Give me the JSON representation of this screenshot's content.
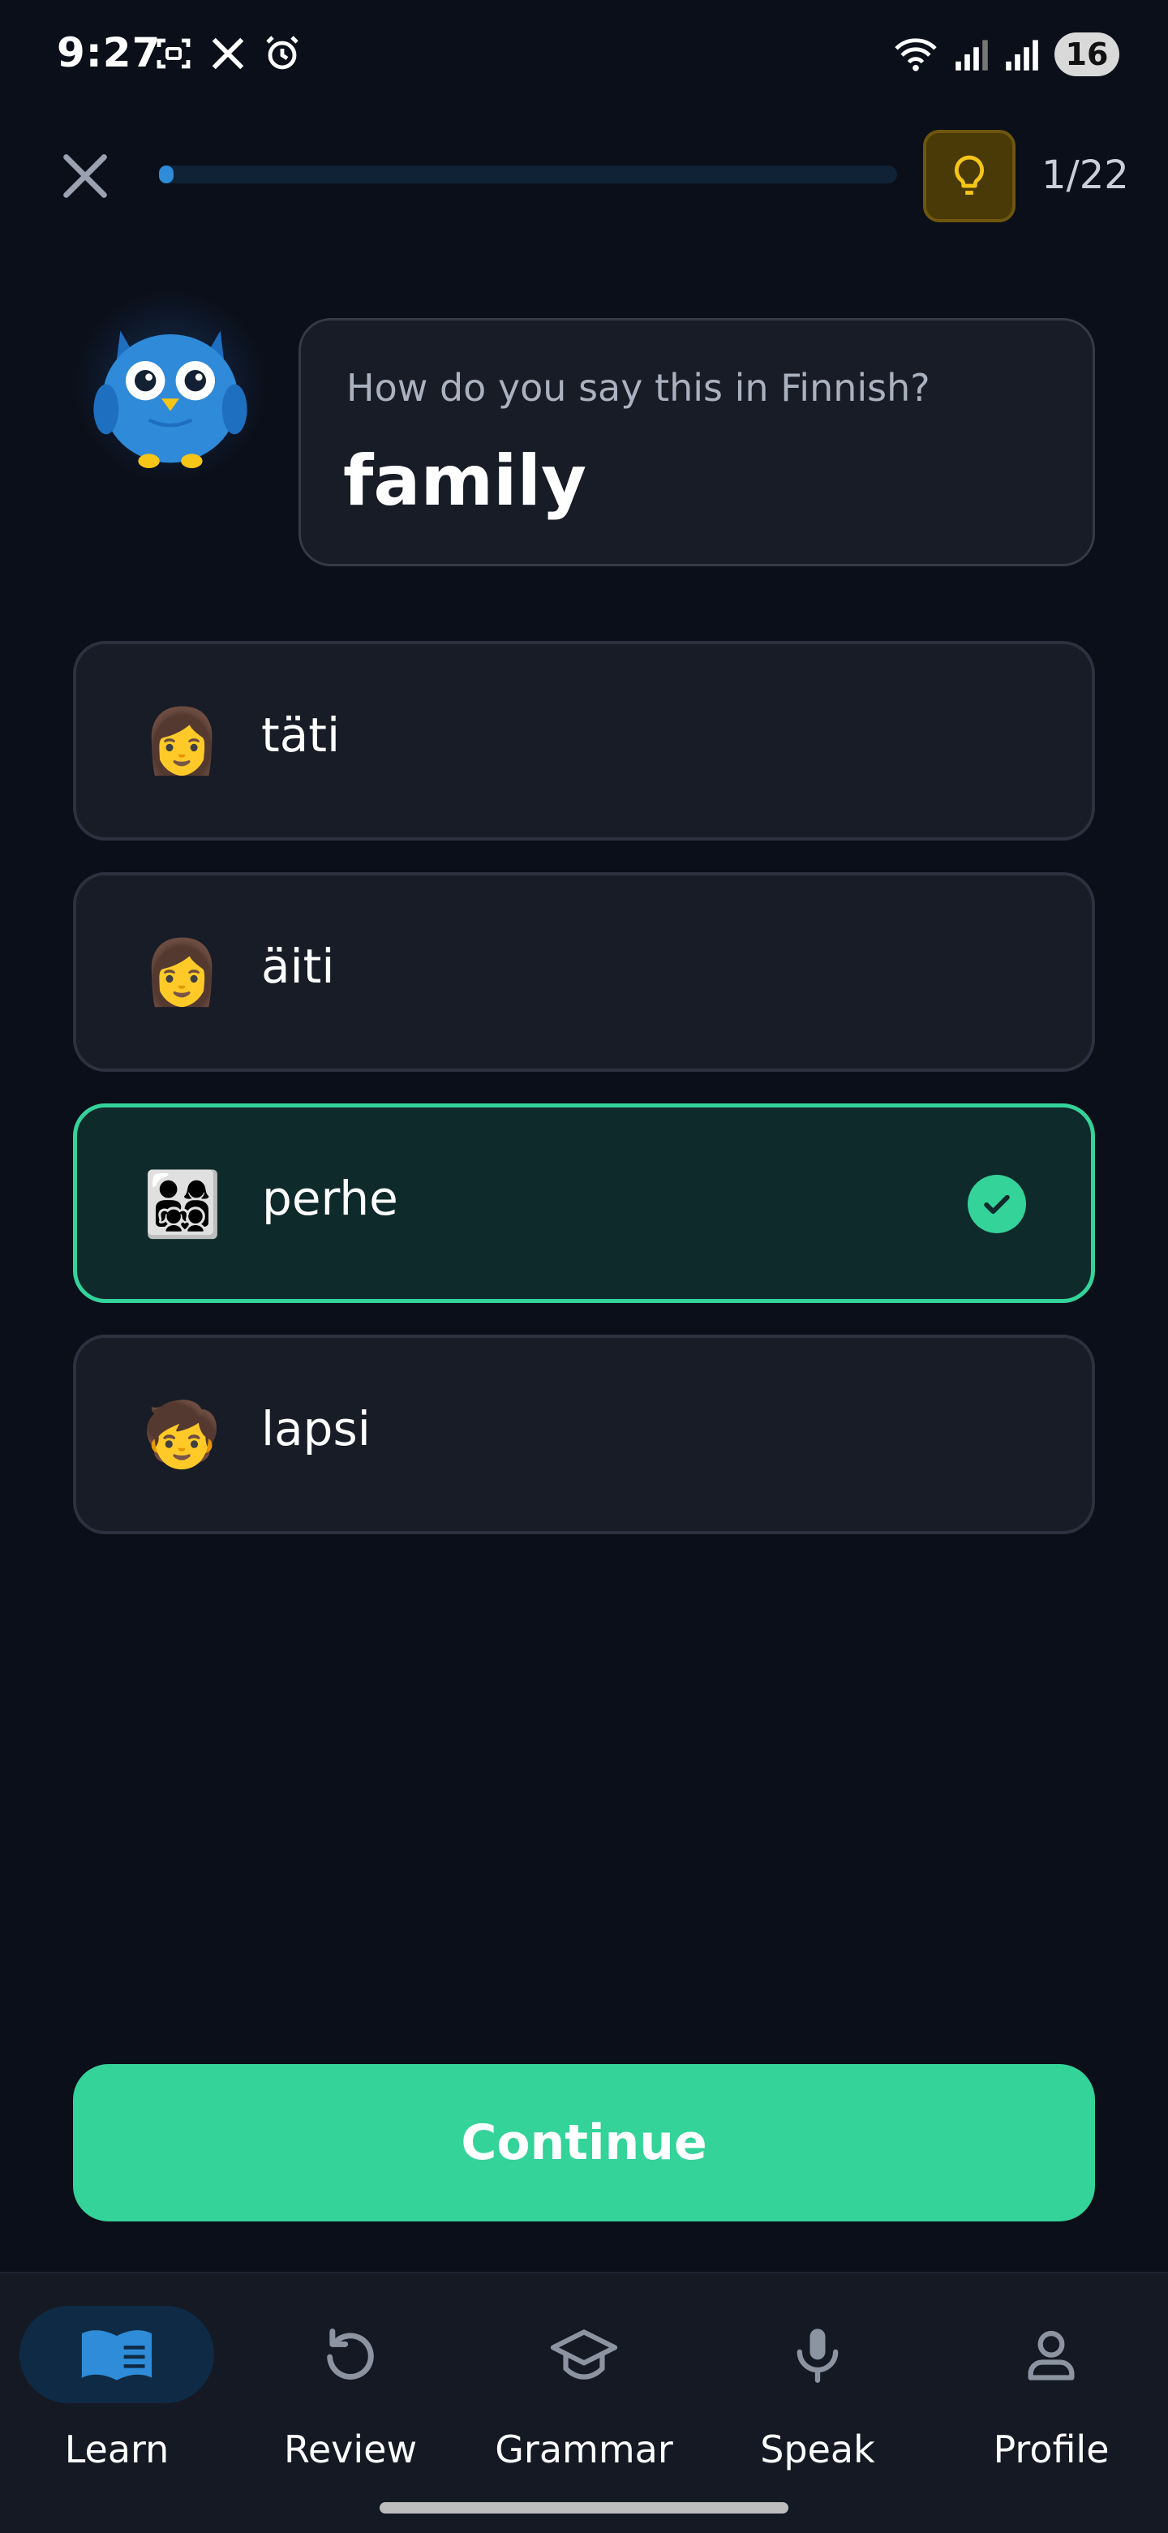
{
  "status_bar": {
    "time": "9:27",
    "battery": "16",
    "left_icons": [
      "screenshot-icon",
      "x-logo-icon",
      "alarm-icon"
    ],
    "right_icons": [
      "wifi-icon",
      "signal-icon",
      "signal-roaming-icon"
    ]
  },
  "top_bar": {
    "close_icon": "close-icon",
    "progress_fraction": 0.02,
    "hint_icon": "lightbulb-icon",
    "counter": "1/22"
  },
  "question": {
    "prompt": "How do you say this in Finnish?",
    "word": "family"
  },
  "options": [
    {
      "emoji": "👩",
      "label": "täti",
      "selected": false
    },
    {
      "emoji": "👩",
      "label": "äiti",
      "selected": false
    },
    {
      "emoji": "👨‍👩‍👧‍👦",
      "label": "perhe",
      "selected": true
    },
    {
      "emoji": "🧒",
      "label": "lapsi",
      "selected": false
    }
  ],
  "continue_label": "Continue",
  "bottom_nav": [
    {
      "label": "Learn",
      "icon": "book-icon",
      "active": true
    },
    {
      "label": "Review",
      "icon": "refresh-icon",
      "active": false
    },
    {
      "label": "Grammar",
      "icon": "graduation-cap-icon",
      "active": false
    },
    {
      "label": "Speak",
      "icon": "microphone-icon",
      "active": false
    },
    {
      "label": "Profile",
      "icon": "person-icon",
      "active": false
    }
  ],
  "colors": {
    "background": "#0b0f19",
    "accent_green": "#34d399",
    "accent_blue": "#2e8cd8",
    "hint_yellow": "#f5c518"
  }
}
